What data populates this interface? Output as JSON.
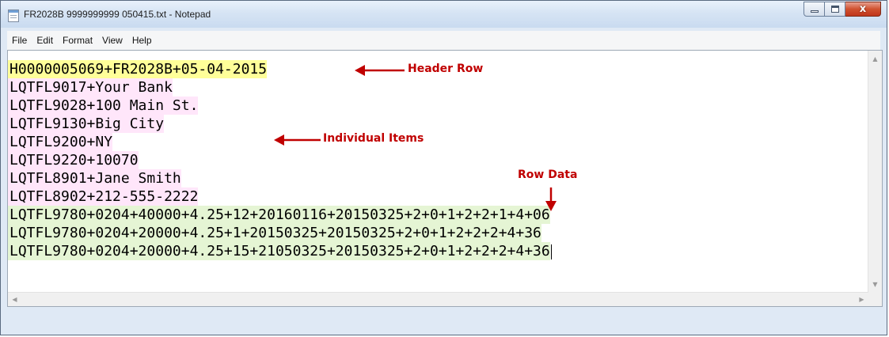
{
  "window": {
    "title": "FR2028B 9999999999 050415.txt - Notepad",
    "close_glyph": "x"
  },
  "menu": [
    "File",
    "Edit",
    "Format",
    "View",
    "Help"
  ],
  "editor": {
    "lines": [
      {
        "text": "H0000005069+FR2028B+05-04-2015",
        "highlight": "yellow"
      },
      {
        "text": "LQTFL9017+Your Bank",
        "highlight": "pink"
      },
      {
        "text": "LQTFL9028+100 Main St.",
        "highlight": "pink"
      },
      {
        "text": "LQTFL9130+Big City",
        "highlight": "pink"
      },
      {
        "text": "LQTFL9200+NY",
        "highlight": "pink"
      },
      {
        "text": "LQTFL9220+10070",
        "highlight": "pink"
      },
      {
        "text": "LQTFL8901+Jane Smith",
        "highlight": "pink"
      },
      {
        "text": "LQTFL8902+212-555-2222",
        "highlight": "pink"
      },
      {
        "text": "LQTFL9780+0204+40000+4.25+12+20160116+20150325+2+0+1+2+2+1+4+06",
        "highlight": "green"
      },
      {
        "text": "LQTFL9780+0204+20000+4.25+1+20150325+20150325+2+0+1+2+2+2+4+36",
        "highlight": "green"
      },
      {
        "text": "LQTFL9780+0204+20000+4.25+15+21050325+20150325+2+0+1+2+2+2+4+36",
        "highlight": "green"
      }
    ]
  },
  "annotations": {
    "header_row": "Header Row",
    "individual_items": "Individual Items",
    "row_data": "Row Data",
    "color": "#c00000"
  },
  "colors": {
    "yellow": "#ffff99",
    "pink": "#ffe6fa",
    "green": "#e5f5d4"
  }
}
